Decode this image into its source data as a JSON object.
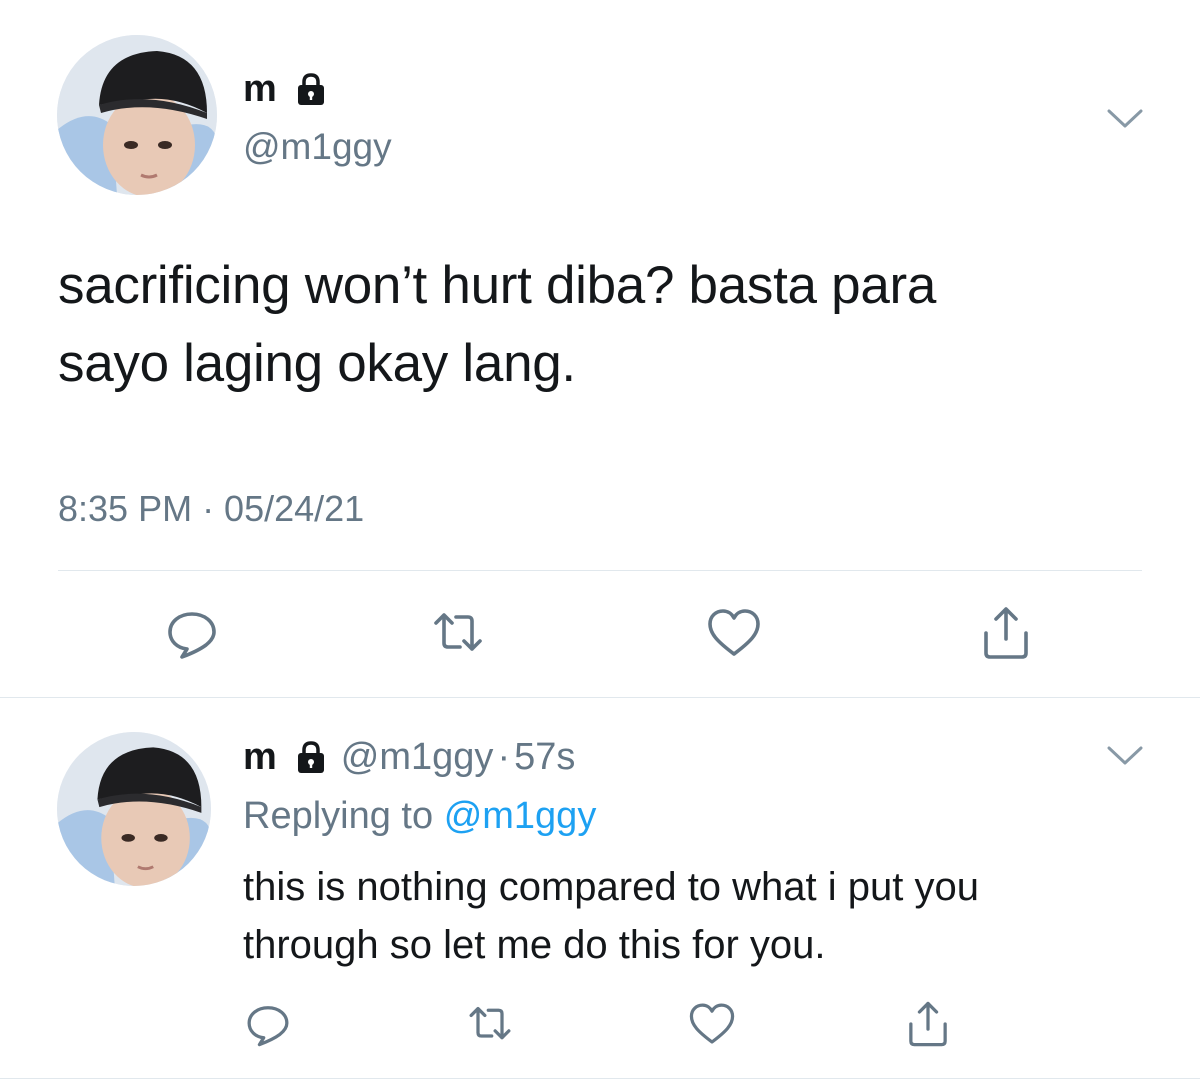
{
  "tweet": {
    "author": {
      "display_name": "m",
      "handle": "@m1ggy",
      "protected": true,
      "avatar_icon": "avatar-person-beanie"
    },
    "text_line1": "sacrificing won’t hurt diba? basta para",
    "text_line2": "sayo laging okay lang.",
    "timestamp": "8:35 PM · 05/24/21",
    "actions": [
      {
        "name": "reply",
        "icon": "comment-icon"
      },
      {
        "name": "retweet",
        "icon": "retweet-icon"
      },
      {
        "name": "like",
        "icon": "heart-icon"
      },
      {
        "name": "share",
        "icon": "share-icon"
      }
    ]
  },
  "reply": {
    "author": {
      "display_name": "m",
      "handle": "@m1ggy",
      "protected": true,
      "avatar_icon": "avatar-person-beanie"
    },
    "separator": "·",
    "time_ago": "57s",
    "replying_prefix": "Replying to",
    "replying_to": "@m1ggy",
    "text_line1": "this is nothing compared to what i put you",
    "text_line2": "through so let me do this for you."
  },
  "colors": {
    "text_primary": "#14171a",
    "text_secondary": "#657786",
    "accent": "#1da1f2",
    "divider": "#e1e8ed"
  }
}
